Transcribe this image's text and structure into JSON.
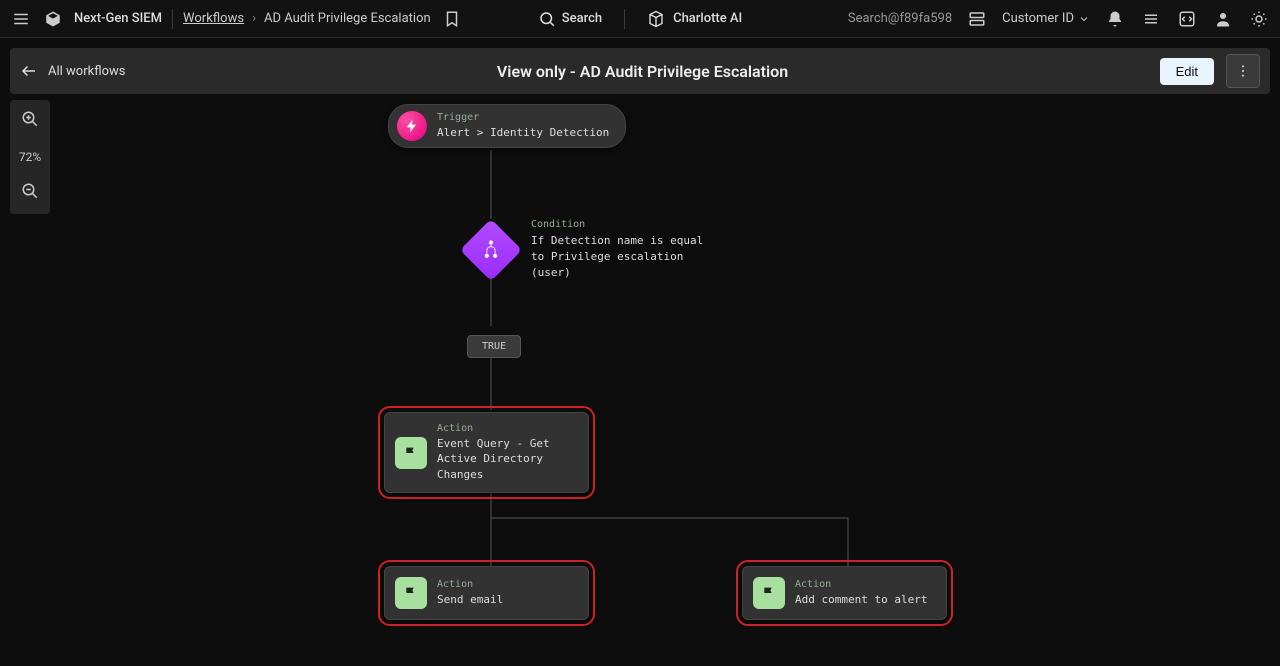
{
  "topnav": {
    "product": "Next-Gen SIEM",
    "workflows_link": "Workflows",
    "current": "AD Audit Privilege Escalation",
    "search_label": "Search",
    "assistant_label": "Charlotte AI",
    "account_text": "Search@f89fa598",
    "customer_id_label": "Customer ID"
  },
  "workbar": {
    "back_label": "All workflows",
    "title": "View only - AD Audit Privilege Escalation",
    "edit_label": "Edit"
  },
  "zoom": {
    "level": "72%"
  },
  "nodes": {
    "trigger": {
      "kind": "Trigger",
      "desc": "Alert > Identity Detection"
    },
    "condition": {
      "kind": "Condition",
      "desc": "If Detection name is equal to Privilege escalation (user)"
    },
    "true_chip": "TRUE",
    "action1": {
      "kind": "Action",
      "desc": "Event Query - Get Active Directory Changes"
    },
    "action2": {
      "kind": "Action",
      "desc": "Send email"
    },
    "action3": {
      "kind": "Action",
      "desc": "Add comment to alert"
    }
  }
}
